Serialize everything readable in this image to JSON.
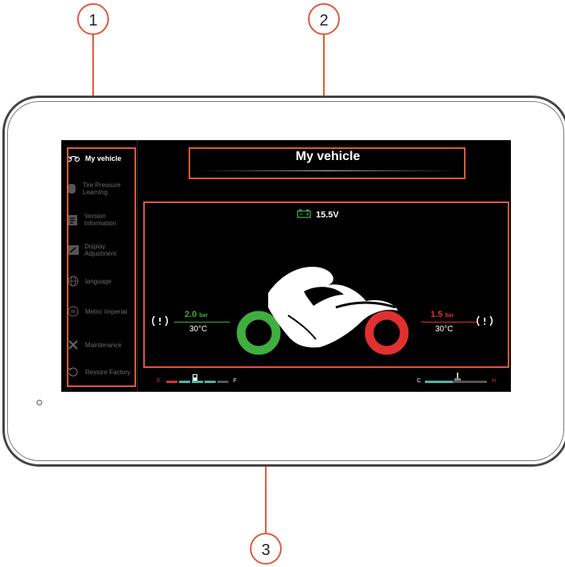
{
  "callouts": [
    "1",
    "2",
    "3"
  ],
  "sidebar": {
    "items": [
      {
        "label": "My vehicle",
        "icon": "motorcycle-icon",
        "active": true
      },
      {
        "label": "Tire Pressure Learning",
        "icon": "tire-icon"
      },
      {
        "label": "Version Information",
        "icon": "document-icon"
      },
      {
        "label": "Display Adjustment",
        "icon": "display-icon"
      },
      {
        "label": "language",
        "icon": "globe-icon"
      },
      {
        "label": "Metric Imperial",
        "icon": "unit-switch-icon"
      },
      {
        "label": "Maintenance",
        "icon": "wrench-icon"
      },
      {
        "label": "Restore Factory",
        "icon": "restore-icon"
      }
    ]
  },
  "header": {
    "title": "My vehicle"
  },
  "battery": {
    "voltage": "15.5V",
    "icon": "battery-icon"
  },
  "front_tire": {
    "pressure": "2.0",
    "unit": "bar",
    "temp": "30°C",
    "color": "#3fae3f",
    "icon": "tpms-warning-icon"
  },
  "rear_tire": {
    "pressure": "1.5",
    "unit": "bar",
    "temp": "30°C",
    "color": "#e0302f",
    "icon": "tpms-warning-icon"
  },
  "fuel": {
    "low_label": "E",
    "high_label": "F",
    "icon": "fuel-icon",
    "level": 0.75
  },
  "coolant": {
    "low_label": "C",
    "high_label": "H",
    "icon": "coolant-temp-icon",
    "level": 0.45
  },
  "colors": {
    "accent": "#e2583a",
    "green": "#3fae3f",
    "red": "#e0302f",
    "teal": "#4fb3a8"
  }
}
